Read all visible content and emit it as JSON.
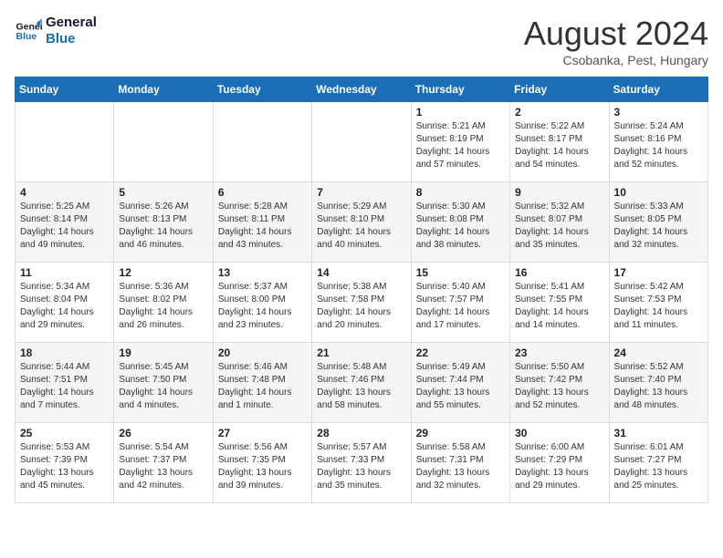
{
  "logo": {
    "line1": "General",
    "line2": "Blue"
  },
  "header": {
    "month": "August 2024",
    "location": "Csobanka, Pest, Hungary"
  },
  "weekdays": [
    "Sunday",
    "Monday",
    "Tuesday",
    "Wednesday",
    "Thursday",
    "Friday",
    "Saturday"
  ],
  "weeks": [
    [
      {
        "day": "",
        "info": ""
      },
      {
        "day": "",
        "info": ""
      },
      {
        "day": "",
        "info": ""
      },
      {
        "day": "",
        "info": ""
      },
      {
        "day": "1",
        "info": "Sunrise: 5:21 AM\nSunset: 8:19 PM\nDaylight: 14 hours\nand 57 minutes."
      },
      {
        "day": "2",
        "info": "Sunrise: 5:22 AM\nSunset: 8:17 PM\nDaylight: 14 hours\nand 54 minutes."
      },
      {
        "day": "3",
        "info": "Sunrise: 5:24 AM\nSunset: 8:16 PM\nDaylight: 14 hours\nand 52 minutes."
      }
    ],
    [
      {
        "day": "4",
        "info": "Sunrise: 5:25 AM\nSunset: 8:14 PM\nDaylight: 14 hours\nand 49 minutes."
      },
      {
        "day": "5",
        "info": "Sunrise: 5:26 AM\nSunset: 8:13 PM\nDaylight: 14 hours\nand 46 minutes."
      },
      {
        "day": "6",
        "info": "Sunrise: 5:28 AM\nSunset: 8:11 PM\nDaylight: 14 hours\nand 43 minutes."
      },
      {
        "day": "7",
        "info": "Sunrise: 5:29 AM\nSunset: 8:10 PM\nDaylight: 14 hours\nand 40 minutes."
      },
      {
        "day": "8",
        "info": "Sunrise: 5:30 AM\nSunset: 8:08 PM\nDaylight: 14 hours\nand 38 minutes."
      },
      {
        "day": "9",
        "info": "Sunrise: 5:32 AM\nSunset: 8:07 PM\nDaylight: 14 hours\nand 35 minutes."
      },
      {
        "day": "10",
        "info": "Sunrise: 5:33 AM\nSunset: 8:05 PM\nDaylight: 14 hours\nand 32 minutes."
      }
    ],
    [
      {
        "day": "11",
        "info": "Sunrise: 5:34 AM\nSunset: 8:04 PM\nDaylight: 14 hours\nand 29 minutes."
      },
      {
        "day": "12",
        "info": "Sunrise: 5:36 AM\nSunset: 8:02 PM\nDaylight: 14 hours\nand 26 minutes."
      },
      {
        "day": "13",
        "info": "Sunrise: 5:37 AM\nSunset: 8:00 PM\nDaylight: 14 hours\nand 23 minutes."
      },
      {
        "day": "14",
        "info": "Sunrise: 5:38 AM\nSunset: 7:58 PM\nDaylight: 14 hours\nand 20 minutes."
      },
      {
        "day": "15",
        "info": "Sunrise: 5:40 AM\nSunset: 7:57 PM\nDaylight: 14 hours\nand 17 minutes."
      },
      {
        "day": "16",
        "info": "Sunrise: 5:41 AM\nSunset: 7:55 PM\nDaylight: 14 hours\nand 14 minutes."
      },
      {
        "day": "17",
        "info": "Sunrise: 5:42 AM\nSunset: 7:53 PM\nDaylight: 14 hours\nand 11 minutes."
      }
    ],
    [
      {
        "day": "18",
        "info": "Sunrise: 5:44 AM\nSunset: 7:51 PM\nDaylight: 14 hours\nand 7 minutes."
      },
      {
        "day": "19",
        "info": "Sunrise: 5:45 AM\nSunset: 7:50 PM\nDaylight: 14 hours\nand 4 minutes."
      },
      {
        "day": "20",
        "info": "Sunrise: 5:46 AM\nSunset: 7:48 PM\nDaylight: 14 hours\nand 1 minute."
      },
      {
        "day": "21",
        "info": "Sunrise: 5:48 AM\nSunset: 7:46 PM\nDaylight: 13 hours\nand 58 minutes."
      },
      {
        "day": "22",
        "info": "Sunrise: 5:49 AM\nSunset: 7:44 PM\nDaylight: 13 hours\nand 55 minutes."
      },
      {
        "day": "23",
        "info": "Sunrise: 5:50 AM\nSunset: 7:42 PM\nDaylight: 13 hours\nand 52 minutes."
      },
      {
        "day": "24",
        "info": "Sunrise: 5:52 AM\nSunset: 7:40 PM\nDaylight: 13 hours\nand 48 minutes."
      }
    ],
    [
      {
        "day": "25",
        "info": "Sunrise: 5:53 AM\nSunset: 7:39 PM\nDaylight: 13 hours\nand 45 minutes."
      },
      {
        "day": "26",
        "info": "Sunrise: 5:54 AM\nSunset: 7:37 PM\nDaylight: 13 hours\nand 42 minutes."
      },
      {
        "day": "27",
        "info": "Sunrise: 5:56 AM\nSunset: 7:35 PM\nDaylight: 13 hours\nand 39 minutes."
      },
      {
        "day": "28",
        "info": "Sunrise: 5:57 AM\nSunset: 7:33 PM\nDaylight: 13 hours\nand 35 minutes."
      },
      {
        "day": "29",
        "info": "Sunrise: 5:58 AM\nSunset: 7:31 PM\nDaylight: 13 hours\nand 32 minutes."
      },
      {
        "day": "30",
        "info": "Sunrise: 6:00 AM\nSunset: 7:29 PM\nDaylight: 13 hours\nand 29 minutes."
      },
      {
        "day": "31",
        "info": "Sunrise: 6:01 AM\nSunset: 7:27 PM\nDaylight: 13 hours\nand 25 minutes."
      }
    ]
  ]
}
